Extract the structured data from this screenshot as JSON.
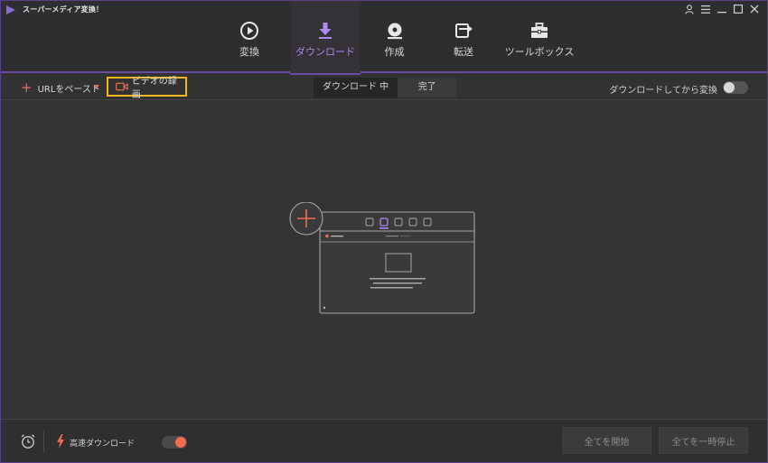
{
  "app": {
    "title": "スーパーメディア変換！"
  },
  "nav": {
    "tabs": [
      {
        "label": "変換",
        "icon": "convert-icon"
      },
      {
        "label": "ダウンロード",
        "icon": "download-icon",
        "active": true
      },
      {
        "label": "作成",
        "icon": "burn-disc-icon"
      },
      {
        "label": "転送",
        "icon": "transfer-icon"
      },
      {
        "label": "ツールボックス",
        "icon": "toolbox-icon"
      }
    ]
  },
  "toolbar": {
    "paste_url_label": "URLをペースト",
    "record_video_label": "ビデオの録画",
    "tabs": {
      "downloading": "ダウンロード 中",
      "completed": "完了"
    },
    "convert_after_download_label": "ダウンロードしてから変換"
  },
  "bottom": {
    "fast_download_label": "高速ダウンロード",
    "start_all_label": "全てを開始",
    "pause_all_label": "全てを一時停止"
  },
  "colors": {
    "accent": "#6a4aa8",
    "accent_text": "#a98bf0",
    "orange": "#ef6b52",
    "highlight": "#f2b51b"
  }
}
